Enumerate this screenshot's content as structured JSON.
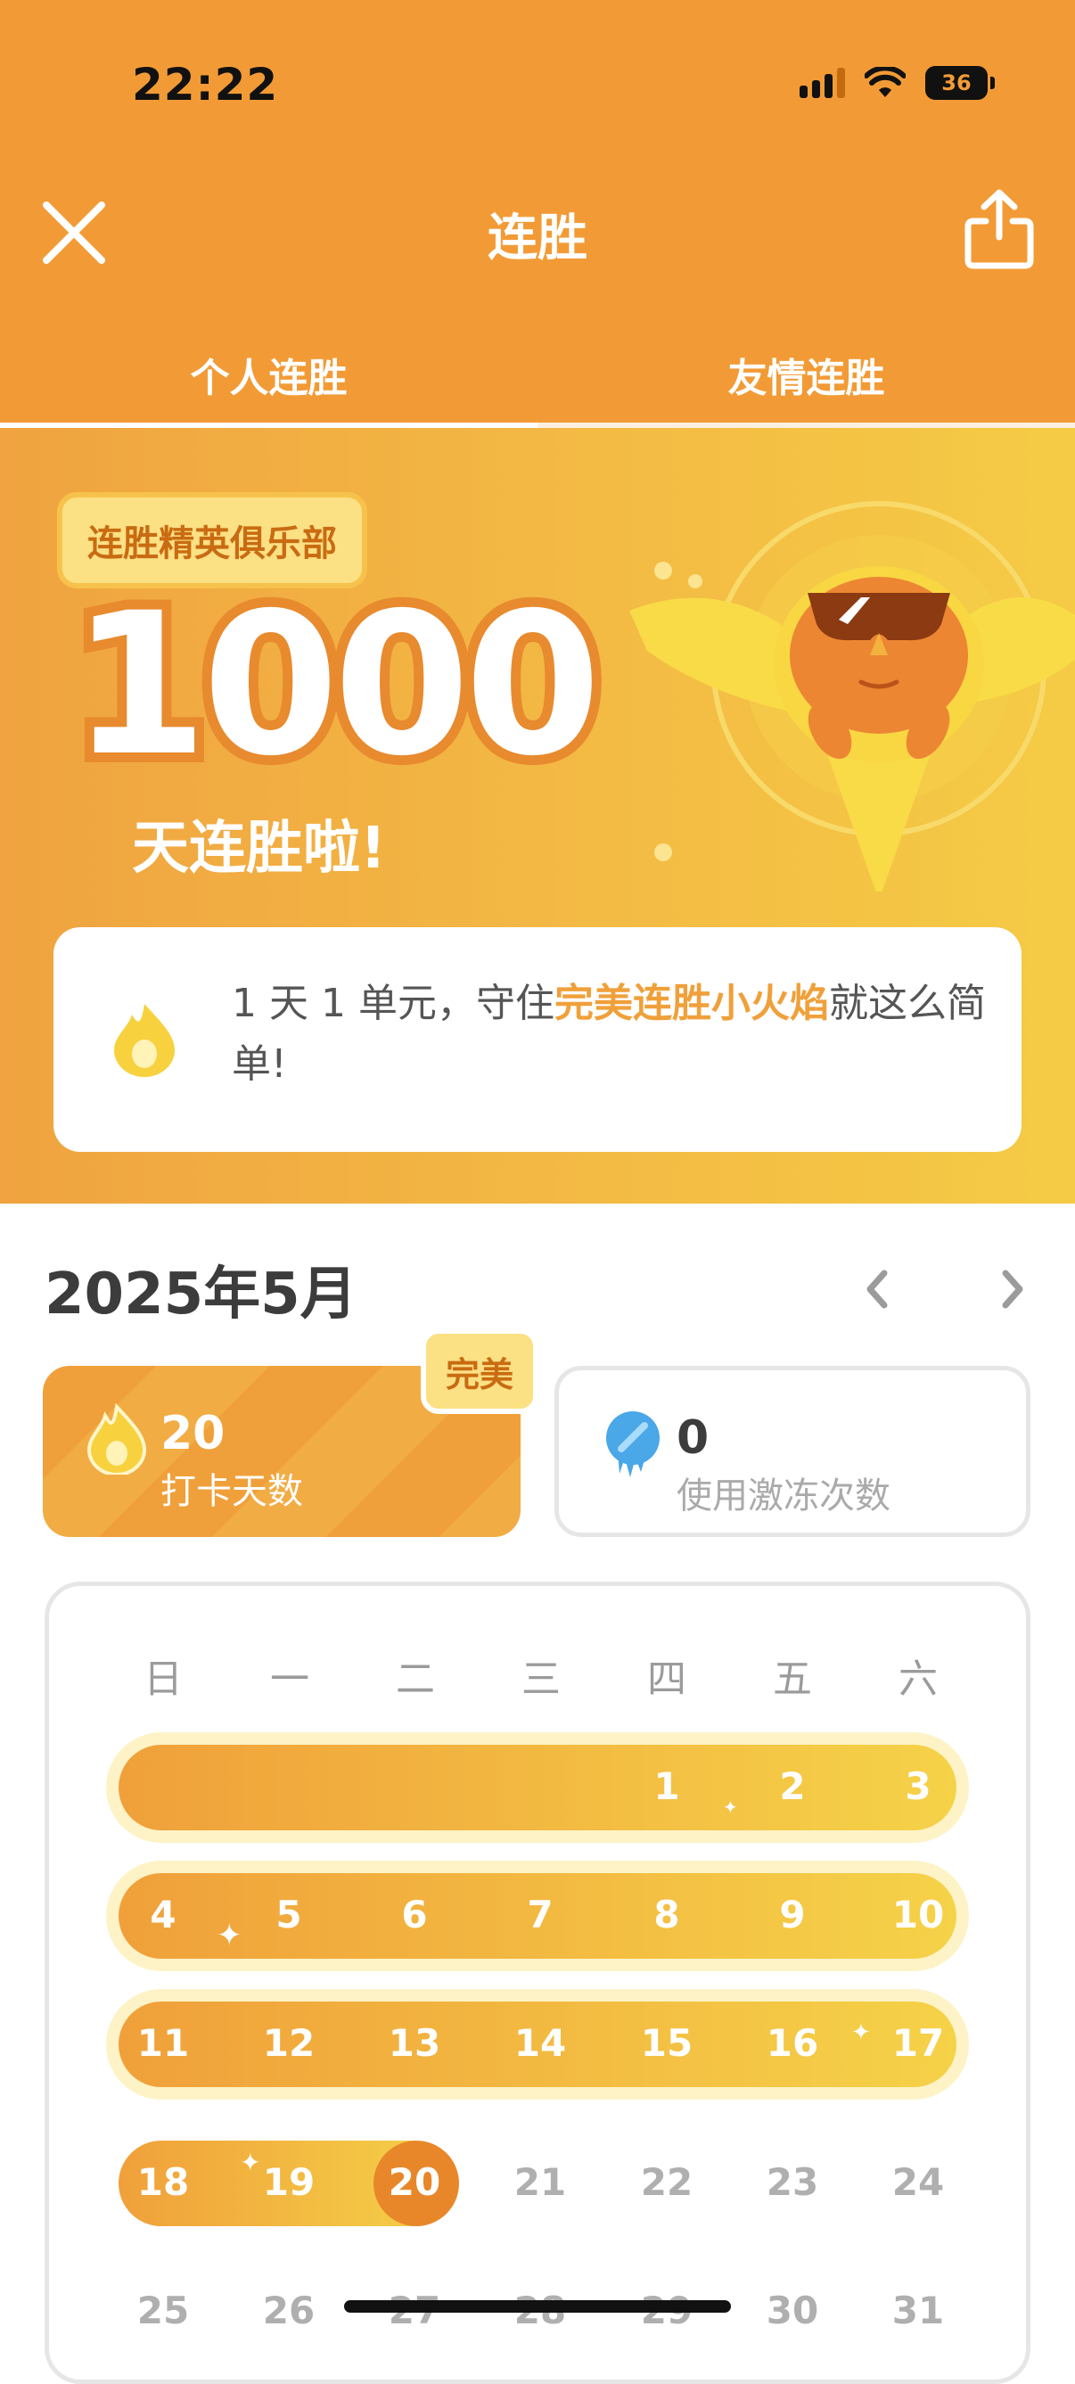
{
  "status_bar": {
    "time": "22:22",
    "battery": "36"
  },
  "nav": {
    "title": "连胜"
  },
  "tabs": [
    {
      "label": "个人连胜",
      "active": true
    },
    {
      "label": "友情连胜",
      "active": false
    }
  ],
  "hero": {
    "club_badge": "连胜精英俱乐部",
    "streak_number": "1000",
    "streak_suffix": "天连胜啦!"
  },
  "promo": {
    "text_before": "1 天 1 单元，守住",
    "text_highlight": "完美连胜小火焰",
    "text_after": "就这么简单!"
  },
  "month": {
    "label": "2025年5月"
  },
  "stats": {
    "perfect_badge": "完美",
    "checkin": {
      "value": "20",
      "label": "打卡天数"
    },
    "freeze": {
      "value": "0",
      "label": "使用激冻次数"
    }
  },
  "calendar": {
    "weekdays": [
      "日",
      "一",
      "二",
      "三",
      "四",
      "五",
      "六"
    ],
    "week1": [
      "1",
      "2",
      "3"
    ],
    "week2": [
      "4",
      "5",
      "6",
      "7",
      "8",
      "9",
      "10"
    ],
    "week3": [
      "11",
      "12",
      "13",
      "14",
      "15",
      "16",
      "17"
    ],
    "week4_active": [
      "18",
      "19",
      "20"
    ],
    "week4_future": [
      "21",
      "22",
      "23",
      "24"
    ],
    "week5": [
      "25",
      "26",
      "27",
      "28",
      "29",
      "30",
      "31"
    ],
    "today": "20"
  },
  "colors": {
    "header": "#F29B36",
    "accent": "#F0A03A",
    "today": "#E8872A"
  }
}
